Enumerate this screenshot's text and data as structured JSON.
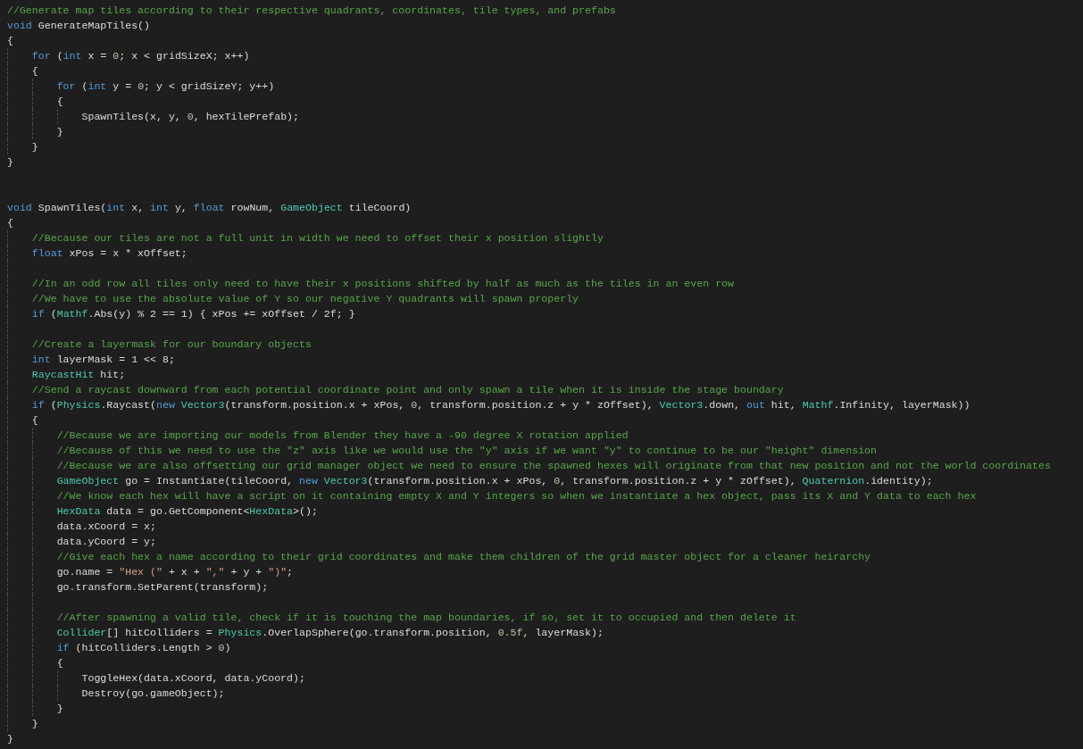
{
  "editor": {
    "lines": [
      {
        "kind": "code",
        "segments": [
          {
            "kind": "comment",
            "text": "//Generate map tiles according to their respective quadrants, coordinates, tile types, and prefabs"
          }
        ]
      },
      {
        "kind": "code",
        "segments": [
          {
            "kind": "keyword",
            "text": "void"
          },
          {
            "kind": "plain",
            "text": " GenerateMapTiles()"
          }
        ]
      },
      {
        "kind": "code",
        "segments": [
          {
            "kind": "plain",
            "text": "{"
          }
        ],
        "children": [
          {
            "kind": "code",
            "segments": [
              {
                "kind": "keyword",
                "text": "for"
              },
              {
                "kind": "plain",
                "text": " ("
              },
              {
                "kind": "keyword",
                "text": "int"
              },
              {
                "kind": "plain",
                "text": " x = "
              },
              {
                "kind": "number",
                "text": "0"
              },
              {
                "kind": "plain",
                "text": "; x < gridSizeX; x++)"
              }
            ]
          },
          {
            "kind": "code",
            "segments": [
              {
                "kind": "plain",
                "text": "{"
              }
            ],
            "children": [
              {
                "kind": "code",
                "segments": [
                  {
                    "kind": "keyword",
                    "text": "for"
                  },
                  {
                    "kind": "plain",
                    "text": " ("
                  },
                  {
                    "kind": "keyword",
                    "text": "int"
                  },
                  {
                    "kind": "plain",
                    "text": " y = "
                  },
                  {
                    "kind": "number",
                    "text": "0"
                  },
                  {
                    "kind": "plain",
                    "text": "; y < gridSizeY; y++)"
                  }
                ]
              },
              {
                "kind": "code",
                "segments": [
                  {
                    "kind": "plain",
                    "text": "{"
                  }
                ],
                "children": [
                  {
                    "kind": "code",
                    "segments": [
                      {
                        "kind": "plain",
                        "text": "SpawnTiles(x, y, "
                      },
                      {
                        "kind": "number",
                        "text": "0"
                      },
                      {
                        "kind": "plain",
                        "text": ", hexTilePrefab);"
                      }
                    ]
                  }
                ]
              },
              {
                "kind": "code",
                "segments": [
                  {
                    "kind": "plain",
                    "text": "}"
                  }
                ]
              }
            ]
          },
          {
            "kind": "code",
            "segments": [
              {
                "kind": "plain",
                "text": "}"
              }
            ]
          }
        ]
      },
      {
        "kind": "code",
        "segments": [
          {
            "kind": "plain",
            "text": "}"
          }
        ]
      },
      {
        "kind": "blank"
      },
      {
        "kind": "blank"
      },
      {
        "kind": "code",
        "segments": [
          {
            "kind": "keyword",
            "text": "void"
          },
          {
            "kind": "plain",
            "text": " SpawnTiles("
          },
          {
            "kind": "keyword",
            "text": "int"
          },
          {
            "kind": "plain",
            "text": " x, "
          },
          {
            "kind": "keyword",
            "text": "int"
          },
          {
            "kind": "plain",
            "text": " y, "
          },
          {
            "kind": "keyword",
            "text": "float"
          },
          {
            "kind": "plain",
            "text": " rowNum, "
          },
          {
            "kind": "type",
            "text": "GameObject"
          },
          {
            "kind": "plain",
            "text": " tileCoord)"
          }
        ]
      },
      {
        "kind": "code",
        "segments": [
          {
            "kind": "plain",
            "text": "{"
          }
        ],
        "children": [
          {
            "kind": "code",
            "segments": [
              {
                "kind": "comment",
                "text": "//Because our tiles are not a full unit in width we need to offset their x position slightly"
              }
            ]
          },
          {
            "kind": "code",
            "segments": [
              {
                "kind": "keyword",
                "text": "float"
              },
              {
                "kind": "plain",
                "text": " xPos = x * xOffset;"
              }
            ]
          },
          {
            "kind": "blank"
          },
          {
            "kind": "code",
            "segments": [
              {
                "kind": "comment",
                "text": "//In an odd row all tiles only need to have their x positions shifted by half as much as the tiles in an even row"
              }
            ]
          },
          {
            "kind": "code",
            "segments": [
              {
                "kind": "comment",
                "text": "//We have to use the absolute value of Y so our negative Y quadrants will spawn properly"
              }
            ]
          },
          {
            "kind": "code",
            "segments": [
              {
                "kind": "keyword",
                "text": "if"
              },
              {
                "kind": "plain",
                "text": " ("
              },
              {
                "kind": "type",
                "text": "Mathf"
              },
              {
                "kind": "plain",
                "text": ".Abs(y) % 2 == 1) { xPos += xOffset / 2f; }"
              }
            ]
          },
          {
            "kind": "blank"
          },
          {
            "kind": "code",
            "segments": [
              {
                "kind": "comment",
                "text": "//Create a layermask for our boundary objects"
              }
            ]
          },
          {
            "kind": "code",
            "segments": [
              {
                "kind": "keyword",
                "text": "int"
              },
              {
                "kind": "plain",
                "text": " layerMask = 1 << 8;"
              }
            ]
          },
          {
            "kind": "code",
            "segments": [
              {
                "kind": "type",
                "text": "RaycastHit"
              },
              {
                "kind": "plain",
                "text": " hit;"
              }
            ]
          },
          {
            "kind": "code",
            "segments": [
              {
                "kind": "comment",
                "text": "//Send a raycast downward from each potential coordinate point and only spawn a tile when it is inside the stage boundary"
              }
            ]
          },
          {
            "kind": "code",
            "segments": [
              {
                "kind": "keyword",
                "text": "if"
              },
              {
                "kind": "plain",
                "text": " ("
              },
              {
                "kind": "type",
                "text": "Physics"
              },
              {
                "kind": "plain",
                "text": ".Raycast("
              },
              {
                "kind": "keyword",
                "text": "new"
              },
              {
                "kind": "type",
                "text": " Vector3"
              },
              {
                "kind": "plain",
                "text": "(transform.position.x + xPos, "
              },
              {
                "kind": "number",
                "text": "0"
              },
              {
                "kind": "plain",
                "text": ", transform.position.z + y * zOffset), "
              },
              {
                "kind": "type",
                "text": "Vector3"
              },
              {
                "kind": "plain",
                "text": ".down, "
              },
              {
                "kind": "keyword",
                "text": "out"
              },
              {
                "kind": "plain",
                "text": " hit, "
              },
              {
                "kind": "type",
                "text": "Mathf"
              },
              {
                "kind": "plain",
                "text": ".Infinity, layerMask))"
              }
            ]
          },
          {
            "kind": "code",
            "segments": [
              {
                "kind": "plain",
                "text": "{"
              }
            ],
            "children": [
              {
                "kind": "code",
                "segments": [
                  {
                    "kind": "comment",
                    "text": "//Because we are importing our models from Blender they have a -90 degree X rotation applied"
                  }
                ]
              },
              {
                "kind": "code",
                "segments": [
                  {
                    "kind": "comment",
                    "text": "//Because of this we need to use the \"z\" axis like we would use the \"y\" axis if we want \"y\" to continue to be our \"height\" dimension"
                  }
                ]
              },
              {
                "kind": "code",
                "segments": [
                  {
                    "kind": "comment",
                    "text": "//Because we are also offsetting our grid manager object we need to ensure the spawned hexes will originate from that new position and not the world coordinates"
                  }
                ]
              },
              {
                "kind": "code",
                "segments": [
                  {
                    "kind": "type",
                    "text": "GameObject"
                  },
                  {
                    "kind": "plain",
                    "text": " go = Instantiate(tileCoord, "
                  },
                  {
                    "kind": "keyword",
                    "text": "new"
                  },
                  {
                    "kind": "type",
                    "text": " Vector3"
                  },
                  {
                    "kind": "plain",
                    "text": "(transform.position.x + xPos, "
                  },
                  {
                    "kind": "number",
                    "text": "0"
                  },
                  {
                    "kind": "plain",
                    "text": ", transform.position.z + y * zOffset), "
                  },
                  {
                    "kind": "type",
                    "text": "Quaternion"
                  },
                  {
                    "kind": "plain",
                    "text": ".identity);"
                  }
                ]
              },
              {
                "kind": "code",
                "segments": [
                  {
                    "kind": "comment",
                    "text": "//We know each hex will have a script on it containing empty X and Y integers so when we instantiate a hex object, pass its X and Y data to each hex"
                  }
                ]
              },
              {
                "kind": "code",
                "segments": [
                  {
                    "kind": "type",
                    "text": "HexData"
                  },
                  {
                    "kind": "plain",
                    "text": " data = go.GetComponent<"
                  },
                  {
                    "kind": "type",
                    "text": "HexData"
                  },
                  {
                    "kind": "plain",
                    "text": ">();"
                  }
                ]
              },
              {
                "kind": "code",
                "segments": [
                  {
                    "kind": "plain",
                    "text": "data.xCoord = x;"
                  }
                ]
              },
              {
                "kind": "code",
                "segments": [
                  {
                    "kind": "plain",
                    "text": "data.yCoord = y;"
                  }
                ]
              },
              {
                "kind": "code",
                "segments": [
                  {
                    "kind": "comment",
                    "text": "//Give each hex a name according to their grid coordinates and make them children of the grid master object for a cleaner heirarchy"
                  }
                ]
              },
              {
                "kind": "code",
                "segments": [
                  {
                    "kind": "plain",
                    "text": "go.name = "
                  },
                  {
                    "kind": "string",
                    "text": "\"Hex (\""
                  },
                  {
                    "kind": "plain",
                    "text": " + x + "
                  },
                  {
                    "kind": "string",
                    "text": "\",\""
                  },
                  {
                    "kind": "plain",
                    "text": " + y + "
                  },
                  {
                    "kind": "string",
                    "text": "\")\""
                  },
                  {
                    "kind": "plain",
                    "text": ";"
                  }
                ]
              },
              {
                "kind": "code",
                "segments": [
                  {
                    "kind": "plain",
                    "text": "go.transform.SetParent(transform);"
                  }
                ]
              },
              {
                "kind": "blank"
              },
              {
                "kind": "code",
                "segments": [
                  {
                    "kind": "comment",
                    "text": "//After spawning a valid tile, check if it is touching the map boundaries, if so, set it to occupied and then delete it"
                  }
                ]
              },
              {
                "kind": "code",
                "segments": [
                  {
                    "kind": "type",
                    "text": "Collider"
                  },
                  {
                    "kind": "plain",
                    "text": "[] hitColliders = "
                  },
                  {
                    "kind": "type",
                    "text": "Physics"
                  },
                  {
                    "kind": "plain",
                    "text": ".OverlapSphere(go.transform.position, "
                  },
                  {
                    "kind": "number",
                    "text": "0.5f"
                  },
                  {
                    "kind": "plain",
                    "text": ", layerMask);"
                  }
                ]
              },
              {
                "kind": "code",
                "segments": [
                  {
                    "kind": "keyword",
                    "text": "if"
                  },
                  {
                    "kind": "plain",
                    "text": " (hitColliders.Length > "
                  },
                  {
                    "kind": "number",
                    "text": "0"
                  },
                  {
                    "kind": "plain",
                    "text": ")"
                  }
                ]
              },
              {
                "kind": "code",
                "segments": [
                  {
                    "kind": "plain",
                    "text": "{"
                  }
                ],
                "children": [
                  {
                    "kind": "code",
                    "segments": [
                      {
                        "kind": "plain",
                        "text": "ToggleHex(data.xCoord, data.yCoord);"
                      }
                    ]
                  },
                  {
                    "kind": "code",
                    "segments": [
                      {
                        "kind": "plain",
                        "text": "Destroy(go.gameObject);"
                      }
                    ]
                  }
                ]
              },
              {
                "kind": "code",
                "segments": [
                  {
                    "kind": "plain",
                    "text": "}"
                  }
                ]
              }
            ]
          },
          {
            "kind": "code",
            "segments": [
              {
                "kind": "plain",
                "text": "}"
              }
            ]
          }
        ]
      },
      {
        "kind": "code",
        "segments": [
          {
            "kind": "plain",
            "text": "}"
          }
        ]
      }
    ]
  }
}
